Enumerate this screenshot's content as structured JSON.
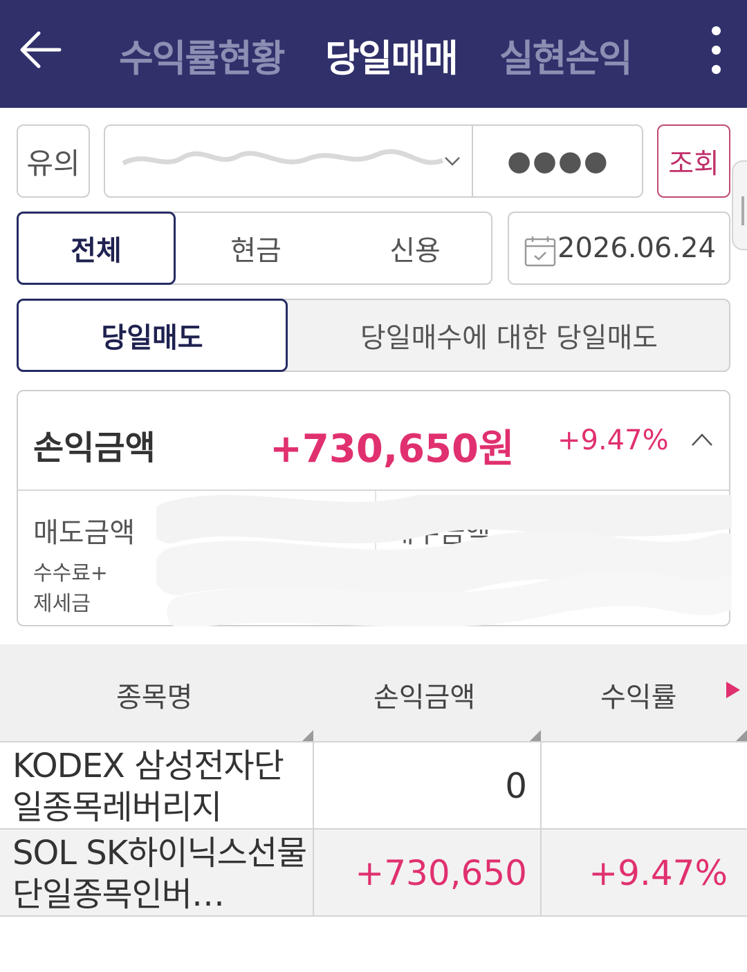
{
  "header": {
    "tabs": [
      {
        "label": "수익률현황",
        "active": false
      },
      {
        "label": "당일매매",
        "active": true
      },
      {
        "label": "실현손익",
        "active": false
      }
    ]
  },
  "account": {
    "caution_label": "유의",
    "password_mask": "●●●●",
    "query_label": "조회"
  },
  "filter": {
    "segments": [
      "전체",
      "현금",
      "신용"
    ],
    "date": "2026.06.24",
    "sell_types": [
      "당일매도",
      "당일매수에 대한 당일매도"
    ]
  },
  "summary": {
    "label": "손익금액",
    "amount": "+730,650원",
    "rate": "+9.47%",
    "sell_amount_label": "매도금액",
    "buy_amount_label": "매수금액",
    "fee_label_line1": "수수료+",
    "fee_label_line2": "제세금"
  },
  "table": {
    "headers": [
      "종목명",
      "손익금액",
      "수익률"
    ],
    "rows": [
      {
        "name": "KODEX 삼성전자단일종목레버리지",
        "pnl": "0",
        "rate": ""
      },
      {
        "name": "SOL SK하이닉스선물단일종목인버…",
        "pnl": "+730,650",
        "rate": "+9.47%"
      }
    ]
  },
  "colors": {
    "header_bg": "#30306b",
    "accent_positive": "#e0306f",
    "active_border": "#262b63"
  }
}
